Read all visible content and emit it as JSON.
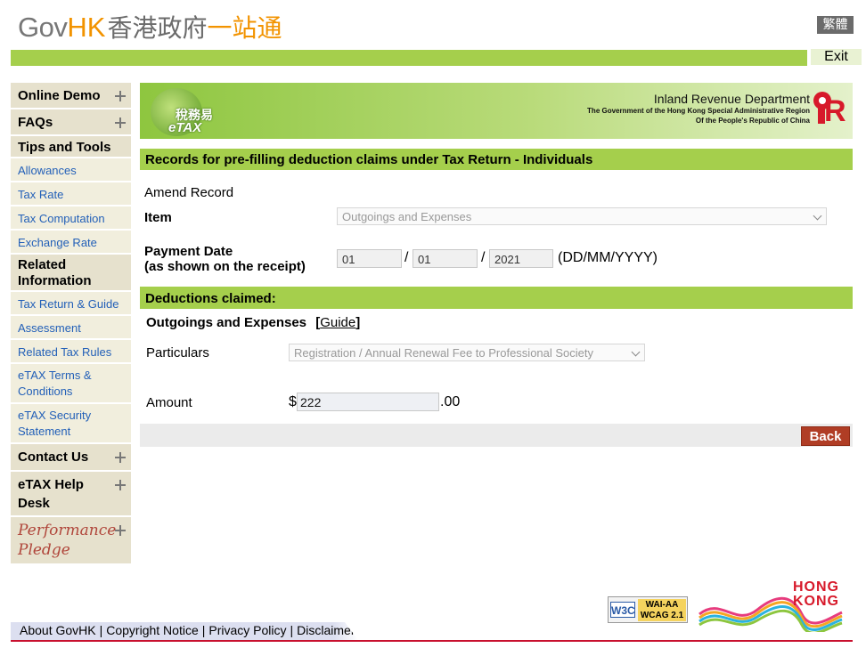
{
  "header": {
    "logo_gov": "Gov",
    "logo_hk": "HK",
    "logo_zh": "香港政府",
    "logo_zh2": "一站通",
    "lang_toggle": "繁體",
    "exit_label": "Exit"
  },
  "sidebar": {
    "online_demo": "Online Demo",
    "faqs": "FAQs",
    "tips_heading": "Tips and Tools",
    "tips_items": [
      "Allowances",
      "Tax Rate",
      "Tax Computation",
      "Exchange Rate"
    ],
    "related_heading": "Related Information",
    "related_items": [
      "Tax Return & Guide",
      "Assessment",
      "Related Tax Rules",
      "eTAX Terms & Conditions",
      "eTAX Security Statement"
    ],
    "contact_us": "Contact Us",
    "etax_help": "eTAX Help Desk",
    "pledge_line1": "Performance",
    "pledge_line2": "Pledge"
  },
  "banner": {
    "etax_zh": "稅務易",
    "etax_en": "eTAX",
    "dept_name": "Inland Revenue Department",
    "dept_line2": "The Government of the Hong Kong Special Administrative Region",
    "dept_line3": "Of the People's Republic of China"
  },
  "main": {
    "page_title": "Records for pre-filling deduction claims under Tax Return - Individuals",
    "mode": "Amend Record",
    "item_label": "Item",
    "item_value": "Outgoings and Expenses",
    "payment_date_label": "Payment Date",
    "payment_date_sub": "(as shown on the receipt)",
    "date_day": "01",
    "date_month": "01",
    "date_year": "2021",
    "date_sep": "/",
    "date_format": "(DD/MM/YYYY)",
    "deductions_heading": "Deductions claimed:",
    "category_title": "Outgoings and Expenses",
    "guide_open": "[",
    "guide_link": "Guide",
    "guide_close": "]",
    "particulars_label": "Particulars",
    "particulars_value": "Registration / Annual Renewal Fee to Professional Society",
    "amount_label": "Amount",
    "currency": "$",
    "amount_value": "222",
    "amount_cents": ".00",
    "back_label": "Back"
  },
  "footer": {
    "links": [
      "About GovHK",
      "Copyright Notice",
      "Privacy Policy",
      "Disclaimer"
    ],
    "sep": "|",
    "w3c": "W3C",
    "wai_line1": "WAI-AA",
    "wai_line2": "WCAG 2.1",
    "brand_line1": "HONG",
    "brand_line2": "KONG"
  },
  "colors": {
    "accent_green": "#a5cf4c",
    "back_button": "#b03d25",
    "link_blue": "#2360b8",
    "brand_orange": "#f29300"
  }
}
